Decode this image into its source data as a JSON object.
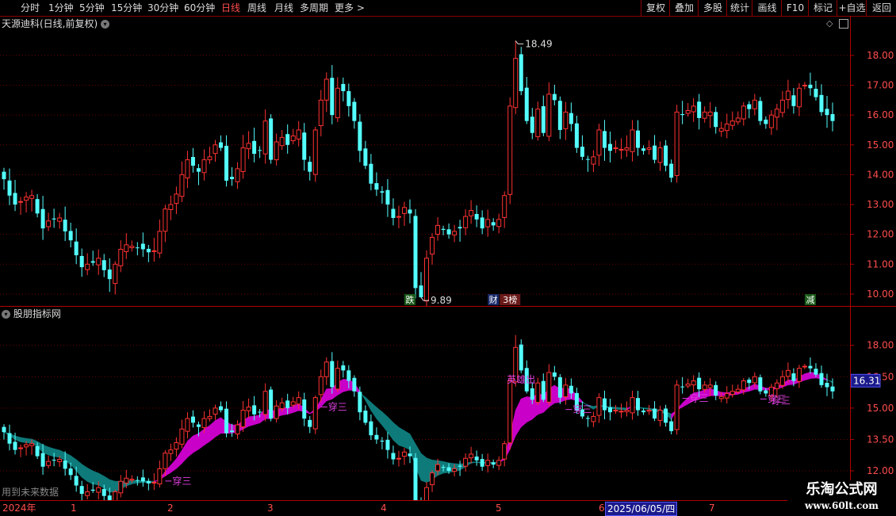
{
  "toolbar": {
    "periods": [
      "分时",
      "1分钟",
      "5分钟",
      "15分钟",
      "30分钟",
      "60分钟",
      "日线",
      "周线",
      "月线",
      "多周期",
      "更多 >"
    ],
    "active_period": "日线",
    "right_buttons": [
      "复权",
      "叠加",
      "多股",
      "统计",
      "画线",
      "F10",
      "标记",
      "+自选",
      "返回"
    ]
  },
  "upper_panel": {
    "title": "天源迪科(日线,前复权)",
    "price_axis": [
      "18.00",
      "17.00",
      "16.00",
      "15.00",
      "14.00",
      "13.00",
      "12.00",
      "11.00",
      "10.00"
    ],
    "high_label": "18.49",
    "low_label": "9.89",
    "markers": [
      "跌",
      "财",
      "3榜",
      "减"
    ]
  },
  "lower_panel": {
    "title": "股朋指标网",
    "price_axis": [
      "18.00",
      "16.50",
      "15.00",
      "13.50",
      "12.00"
    ],
    "current_price": "16.31",
    "signal_labels": [
      "穿三",
      "穿三",
      "穿三",
      "穿三",
      "穿三",
      "英雄出",
      "穿三"
    ],
    "future_note": "用到未来数据"
  },
  "date_axis": {
    "year": "2024年",
    "months": [
      "1",
      "2",
      "3",
      "4",
      "5",
      "6",
      "7"
    ],
    "readout": "2025/06/05/四"
  },
  "watermark": {
    "title": "乐淘公式网",
    "url": "www.60lt.com"
  },
  "colors": {
    "up": "#ff3232",
    "down": "#54ffff",
    "ribbon_up": "#c800c8",
    "ribbon_down": "#0f7a7a",
    "axis": "#b00000"
  },
  "chart_data": {
    "type": "candlestick",
    "price_unit": "CNY",
    "ylim_upper": [
      9.6,
      18.9
    ],
    "ylim_lower": [
      10.6,
      19.2
    ],
    "closes": [
      13.85,
      13.3,
      13.0,
      13.1,
      13.25,
      13.3,
      12.7,
      12.2,
      12.45,
      12.5,
      12.55,
      12.1,
      11.8,
      11.3,
      10.9,
      11.0,
      11.05,
      11.2,
      10.8,
      10.5,
      11.0,
      11.5,
      11.65,
      11.6,
      11.55,
      11.5,
      11.4,
      11.45,
      12.1,
      12.85,
      13.0,
      13.35,
      14.0,
      14.5,
      14.3,
      14.1,
      14.5,
      14.6,
      15.0,
      14.9,
      13.8,
      13.85,
      14.2,
      14.9,
      15.05,
      14.7,
      14.8,
      15.8,
      14.5,
      15.1,
      15.25,
      15.0,
      15.3,
      15.5,
      14.5,
      14.1,
      15.5,
      16.5,
      17.2,
      16.0,
      16.9,
      16.8,
      16.3,
      15.8,
      14.8,
      14.3,
      13.7,
      13.5,
      13.4,
      13.0,
      12.55,
      12.6,
      12.9,
      12.7,
      10.2,
      9.89,
      11.2,
      11.9,
      12.3,
      12.15,
      12.0,
      12.1,
      12.2,
      12.6,
      12.8,
      12.5,
      12.2,
      12.5,
      12.3,
      12.5,
      13.3,
      16.3,
      17.9,
      16.8,
      15.8,
      15.4,
      16.2,
      15.4,
      16.7,
      16.5,
      15.5,
      16.1,
      15.7,
      14.9,
      14.6,
      14.5,
      14.6,
      15.5,
      14.9,
      14.8,
      14.9,
      14.85,
      14.9,
      15.5,
      14.9,
      14.8,
      14.9,
      14.5,
      14.9,
      14.3,
      13.9,
      16.1,
      16.0,
      16.15,
      16.3,
      15.9,
      16.1,
      16.1,
      15.6,
      15.55,
      15.7,
      15.8,
      15.9,
      16.3,
      16.2,
      16.5,
      15.8,
      15.7,
      16.0,
      16.2,
      16.5,
      16.8,
      16.3,
      16.9,
      17.0,
      16.9,
      16.6,
      16.1,
      16.0,
      15.8
    ],
    "high": 18.49,
    "low": 9.89,
    "last_price": 16.31
  }
}
